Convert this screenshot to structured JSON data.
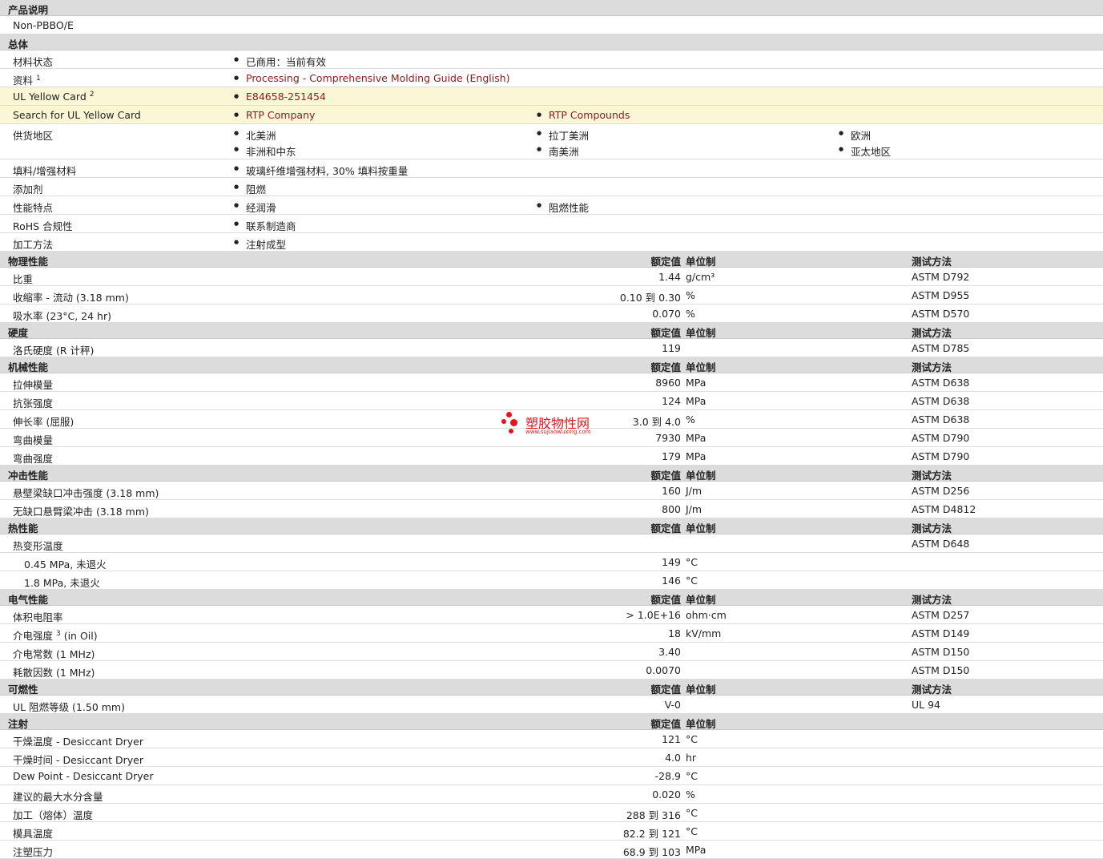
{
  "col_headers": {
    "value": "额定值",
    "unit": "单位制",
    "test": "测试方法"
  },
  "desc": {
    "title": "产品说明",
    "text": "Non-PBBO/E"
  },
  "general": {
    "title": "总体",
    "material_status": {
      "label": "材料状态",
      "value": "已商用：当前有效"
    },
    "docs": {
      "label": "资料",
      "sup": "1",
      "link": "Processing - Comprehensive Molding Guide (English)"
    },
    "ul_card": {
      "label": "UL Yellow Card",
      "sup": "2",
      "link": "E84658-251454"
    },
    "ul_search": {
      "label": "Search for UL Yellow Card",
      "link1": "RTP Company",
      "link2": "RTP Compounds"
    },
    "supply": {
      "label": "供货地区",
      "regions": [
        "北美洲",
        "拉丁美洲",
        "欧洲",
        "非洲和中东",
        "南美洲",
        "亚太地区"
      ]
    },
    "filler": {
      "label": "填料/增强材料",
      "value": "玻璃纤维增强材料, 30% 填料按重量"
    },
    "additive": {
      "label": "添加剂",
      "value": "阻燃"
    },
    "features": {
      "label": "性能特点",
      "value1": "经润滑",
      "value2": "阻燃性能"
    },
    "rohs": {
      "label": "RoHS 合规性",
      "value": "联系制造商"
    },
    "process": {
      "label": "加工方法",
      "value": "注射成型"
    }
  },
  "physical": {
    "title": "物理性能",
    "rows": [
      {
        "label": "比重",
        "value": "1.44",
        "unit": "g/cm³",
        "test": "ASTM D792"
      },
      {
        "label": "收缩率  - 流动  (3.18 mm)",
        "value": "0.10 到  0.30",
        "unit": "%",
        "test": "ASTM D955"
      },
      {
        "label": "吸水率  (23°C, 24 hr)",
        "value": "0.070",
        "unit": "%",
        "test": "ASTM D570"
      }
    ]
  },
  "hardness": {
    "title": "硬度",
    "rows": [
      {
        "label": "洛氏硬度  (R 计秤)",
        "value": "119",
        "unit": "",
        "test": "ASTM D785"
      }
    ]
  },
  "mechanical": {
    "title": "机械性能",
    "rows": [
      {
        "label": "拉伸模量",
        "value": "8960",
        "unit": "MPa",
        "test": "ASTM D638"
      },
      {
        "label": "抗张强度",
        "value": "124",
        "unit": "MPa",
        "test": "ASTM D638"
      },
      {
        "label": "伸长率  (屈服)",
        "value": "3.0 到  4.0",
        "unit": "%",
        "test": "ASTM D638"
      },
      {
        "label": "弯曲模量",
        "value": "7930",
        "unit": "MPa",
        "test": "ASTM D790"
      },
      {
        "label": "弯曲强度",
        "value": "179",
        "unit": "MPa",
        "test": "ASTM D790"
      }
    ]
  },
  "impact": {
    "title": "冲击性能",
    "rows": [
      {
        "label": "悬壁梁缺口冲击强度  (3.18 mm)",
        "value": "160",
        "unit": "J/m",
        "test": "ASTM D256"
      },
      {
        "label": "无缺口悬臂梁冲击  (3.18 mm)",
        "value": "800",
        "unit": "J/m",
        "test": "ASTM D4812"
      }
    ]
  },
  "thermal": {
    "title": "热性能",
    "hdt": {
      "label": "热变形温度",
      "test": "ASTM D648"
    },
    "rows": [
      {
        "label": "0.45 MPa, 未退火",
        "value": "149",
        "unit": "°C"
      },
      {
        "label": "1.8 MPa, 未退火",
        "value": "146",
        "unit": "°C"
      }
    ]
  },
  "electrical": {
    "title": "电气性能",
    "rows": [
      {
        "label": "体积电阻率",
        "value": "> 1.0E+16",
        "unit": "ohm·cm",
        "test": "ASTM D257"
      },
      {
        "label": "介电强度",
        "sup": "3",
        "suffix": " (in Oil)",
        "value": "18",
        "unit": "kV/mm",
        "test": "ASTM D149"
      },
      {
        "label": "介电常数  (1 MHz)",
        "value": "3.40",
        "unit": "",
        "test": "ASTM D150"
      },
      {
        "label": "耗散因数  (1 MHz)",
        "value": "0.0070",
        "unit": "",
        "test": "ASTM D150"
      }
    ]
  },
  "flammability": {
    "title": "可燃性",
    "rows": [
      {
        "label": "UL 阻燃等级  (1.50 mm)",
        "value": "V-0",
        "unit": "",
        "test": "UL 94"
      }
    ]
  },
  "injection": {
    "title": "注射",
    "rows": [
      {
        "label": "干燥温度  - Desiccant Dryer",
        "value": "121",
        "unit": "°C"
      },
      {
        "label": "干燥时间  - Desiccant Dryer",
        "value": "4.0",
        "unit": "hr"
      },
      {
        "label": "Dew Point - Desiccant Dryer",
        "value": "-28.9",
        "unit": "°C"
      },
      {
        "label": "建议的最大水分含量",
        "value": "0.020",
        "unit": "%"
      },
      {
        "label": "加工（熔体）温度",
        "value": "288 到  316",
        "unit": "°C"
      },
      {
        "label": "模具温度",
        "value": "82.2 到  121",
        "unit": "°C"
      },
      {
        "label": "注塑压力",
        "value": "68.9 到  103",
        "unit": "MPa"
      }
    ]
  },
  "watermark": {
    "title": "塑胶物性网",
    "url": "www.sujiaowuxing.com"
  }
}
